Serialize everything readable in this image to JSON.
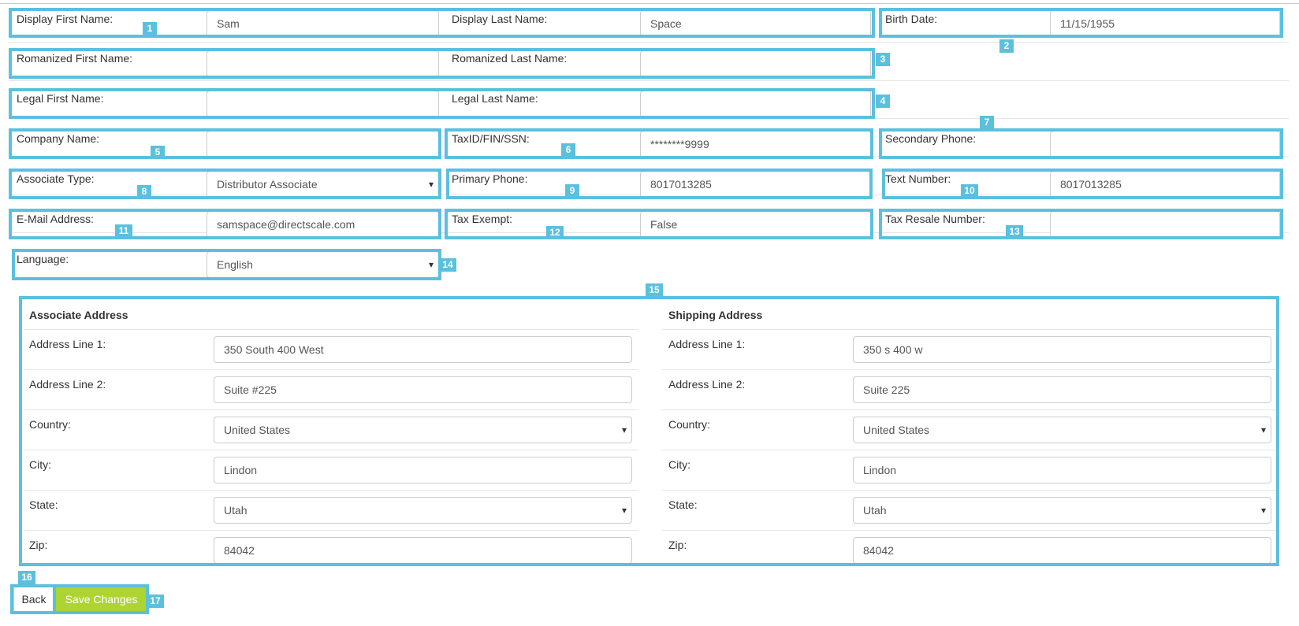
{
  "colors": {
    "highlight": "#5bc0de",
    "save_button": "#aed432"
  },
  "personal": {
    "display_first_name": {
      "label": "Display First Name:",
      "value": "Sam"
    },
    "display_last_name": {
      "label": "Display Last Name:",
      "value": "Space"
    },
    "birth_date": {
      "label": "Birth Date:",
      "value": "11/15/1955"
    },
    "romanized_first_name": {
      "label": "Romanized First Name:",
      "value": ""
    },
    "romanized_last_name": {
      "label": "Romanized Last Name:",
      "value": ""
    },
    "legal_first_name": {
      "label": "Legal First Name:",
      "value": ""
    },
    "legal_last_name": {
      "label": "Legal Last Name:",
      "value": ""
    },
    "company_name": {
      "label": "Company Name:",
      "value": ""
    },
    "tax_id": {
      "label": "TaxID/FIN/SSN:",
      "value": "********9999"
    },
    "secondary_phone": {
      "label": "Secondary Phone:",
      "value": ""
    },
    "associate_type": {
      "label": "Associate Type:",
      "value": "Distributor Associate"
    },
    "primary_phone": {
      "label": "Primary Phone:",
      "value": "8017013285"
    },
    "text_number": {
      "label": "Text Number:",
      "value": "8017013285"
    },
    "email": {
      "label": "E-Mail Address:",
      "value": "samspace@directscale.com"
    },
    "tax_exempt": {
      "label": "Tax Exempt:",
      "value": "False"
    },
    "tax_resale_number": {
      "label": "Tax Resale Number:",
      "value": ""
    },
    "language": {
      "label": "Language:",
      "value": "English"
    }
  },
  "associate_address": {
    "heading": "Associate Address",
    "line1": {
      "label": "Address Line 1:",
      "value": "350 South 400 West"
    },
    "line2": {
      "label": "Address Line 2:",
      "value": "Suite #225"
    },
    "country": {
      "label": "Country:",
      "value": "United States"
    },
    "city": {
      "label": "City:",
      "value": "Lindon"
    },
    "state": {
      "label": "State:",
      "value": "Utah"
    },
    "zip": {
      "label": "Zip:",
      "value": "84042"
    }
  },
  "shipping_address": {
    "heading": "Shipping Address",
    "line1": {
      "label": "Address Line 1:",
      "value": "350 s 400 w"
    },
    "line2": {
      "label": "Address Line 2:",
      "value": "Suite 225"
    },
    "country": {
      "label": "Country:",
      "value": "United States"
    },
    "city": {
      "label": "City:",
      "value": "Lindon"
    },
    "state": {
      "label": "State:",
      "value": "Utah"
    },
    "zip": {
      "label": "Zip:",
      "value": "84042"
    }
  },
  "actions": {
    "back_label": "Back",
    "save_label": "Save Changes"
  },
  "badges": [
    "1",
    "2",
    "3",
    "4",
    "5",
    "6",
    "7",
    "8",
    "9",
    "10",
    "11",
    "12",
    "13",
    "14",
    "15",
    "16",
    "17"
  ]
}
